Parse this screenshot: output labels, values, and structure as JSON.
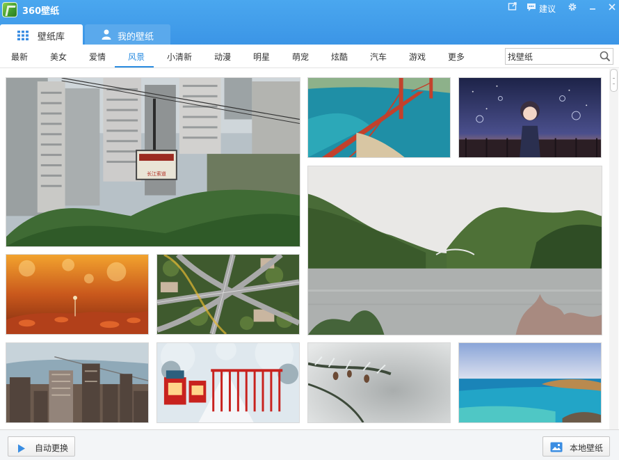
{
  "app": {
    "title": "360壁纸"
  },
  "titlebar": {
    "suggest_label": "建议"
  },
  "tabs": [
    {
      "label": "壁纸库",
      "active": true
    },
    {
      "label": "我的壁纸",
      "active": false
    }
  ],
  "categories": [
    {
      "label": "最新"
    },
    {
      "label": "美女"
    },
    {
      "label": "爱情"
    },
    {
      "label": "风景",
      "active": true
    },
    {
      "label": "小清新"
    },
    {
      "label": "动漫"
    },
    {
      "label": "明星"
    },
    {
      "label": "萌宠"
    },
    {
      "label": "炫酷"
    },
    {
      "label": "汽车"
    },
    {
      "label": "游戏"
    },
    {
      "label": "更多"
    }
  ],
  "search": {
    "value": "找壁纸"
  },
  "footer": {
    "auto_change_label": "自动更换",
    "local_wallpaper_label": "本地壁纸"
  },
  "cable_car_sign": "长江索道",
  "colors": {
    "titlebar": "#3d97e7",
    "accent": "#2a8ce0",
    "tab_inactive": "#5aa9ec"
  }
}
